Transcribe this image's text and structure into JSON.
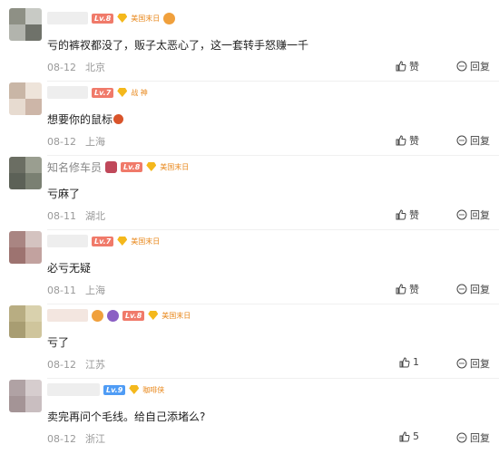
{
  "actions": {
    "like_label": "赞",
    "reply_label": "回复"
  },
  "comments": [
    {
      "avatar_colors": [
        "#8e9085",
        "#c8cac5",
        "#b2b4ad",
        "#6f726a"
      ],
      "username": "",
      "level": "Lv.8",
      "badge_text": "美国末日",
      "text": "亏的裤衩都没了，贩子太恶心了，这一套转手怒赚一千",
      "date": "08-12",
      "location": "北京",
      "likes": "赞"
    },
    {
      "avatar_colors": [
        "#c9b6a6",
        "#eee4da",
        "#e7dbd0",
        "#cdb6a8"
      ],
      "username": "",
      "level": "Lv.7",
      "badge_text": "战 神",
      "text": "想要你的鼠标",
      "date": "08-12",
      "location": "上海",
      "likes": "赞"
    },
    {
      "avatar_colors": [
        "#6b6e63",
        "#9a9e90",
        "#5c6157",
        "#7a8072"
      ],
      "username": "知名修车员",
      "level": "Lv.8",
      "badge_text": "美国末日",
      "text": "亏麻了",
      "date": "08-11",
      "location": "湖北",
      "likes": "赞"
    },
    {
      "avatar_colors": [
        "#a98582",
        "#d4c3c0",
        "#9d7370",
        "#c2a29f"
      ],
      "username": "",
      "level": "Lv.7",
      "badge_text": "美国末日",
      "text": "必亏无疑",
      "date": "08-11",
      "location": "上海",
      "likes": "赞"
    },
    {
      "avatar_colors": [
        "#b8ad82",
        "#d9d1ad",
        "#a89d72",
        "#cfc59c"
      ],
      "username": "",
      "level": "Lv.8",
      "badge_text": "美国末日",
      "text": "亏了",
      "date": "08-12",
      "location": "江苏",
      "likes": "1"
    },
    {
      "avatar_colors": [
        "#b0a2a4",
        "#d6cdce",
        "#a49496",
        "#c9bec0"
      ],
      "username": "",
      "level": "Lv.9",
      "badge_text": "咖啡侠",
      "text": "卖完再问个毛线。给自己添堵么?",
      "date": "08-12",
      "location": "浙江",
      "likes": "5"
    }
  ]
}
